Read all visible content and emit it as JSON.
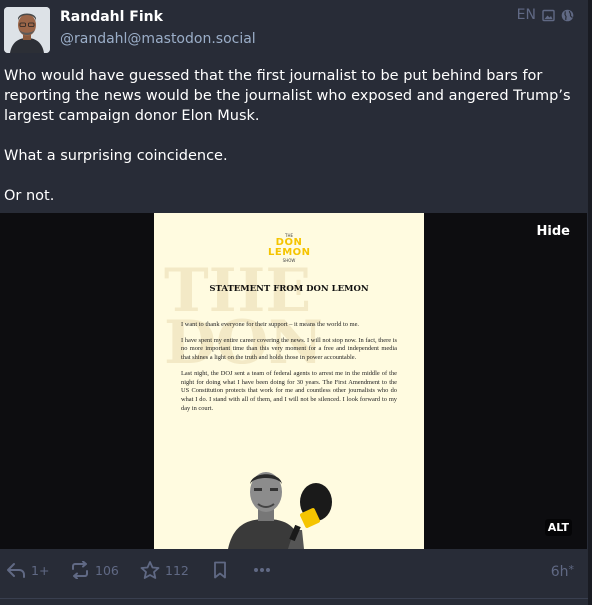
{
  "post": {
    "author_name": "Randahl Fink",
    "author_handle": "@randahl@mastodon.social",
    "language": "EN",
    "visibility_icon": "globe-icon",
    "media_icon": "image-icon",
    "paragraphs": [
      "Who would have guessed that the first journalist to be put behind bars for reporting the news would be the journalist who exposed and angered Trump’s largest campaign donor Elon Musk.",
      "What a surprising coincidence.",
      "Or not."
    ],
    "time": "6h",
    "time_suffix": "*"
  },
  "media": {
    "hide_label": "Hide",
    "alt_label": "ALT",
    "logo": {
      "the": "THE",
      "don": "DON",
      "lemon": "LEMON",
      "show": "SHOW"
    },
    "watermark": "THE DON",
    "headline": "STATEMENT FROM DON LEMON",
    "body": [
      "I want to thank everyone for their support – it means the world to me.",
      "I have spent my entire career covering the news. I will not stop now. In fact, there is no more important time than this very moment for a free and independent media that shines a light on the truth and holds those in power accountable.",
      "Last night, the DOJ sent a team of federal agents to arrest me in the middle of the night for doing what I have been doing for 30 years. The First Amendment to the US Constitution protects that work for me and countless other journalists who do what I do. I stand with all of them, and I will not be silenced. I look forward to my day in court."
    ]
  },
  "actions": {
    "reply_count": "1+",
    "boost_count": "106",
    "favourite_count": "112"
  },
  "colors": {
    "background": "#282c37",
    "muted": "#606984",
    "handle": "#9baec8",
    "accent_yellow": "#f5c400"
  }
}
